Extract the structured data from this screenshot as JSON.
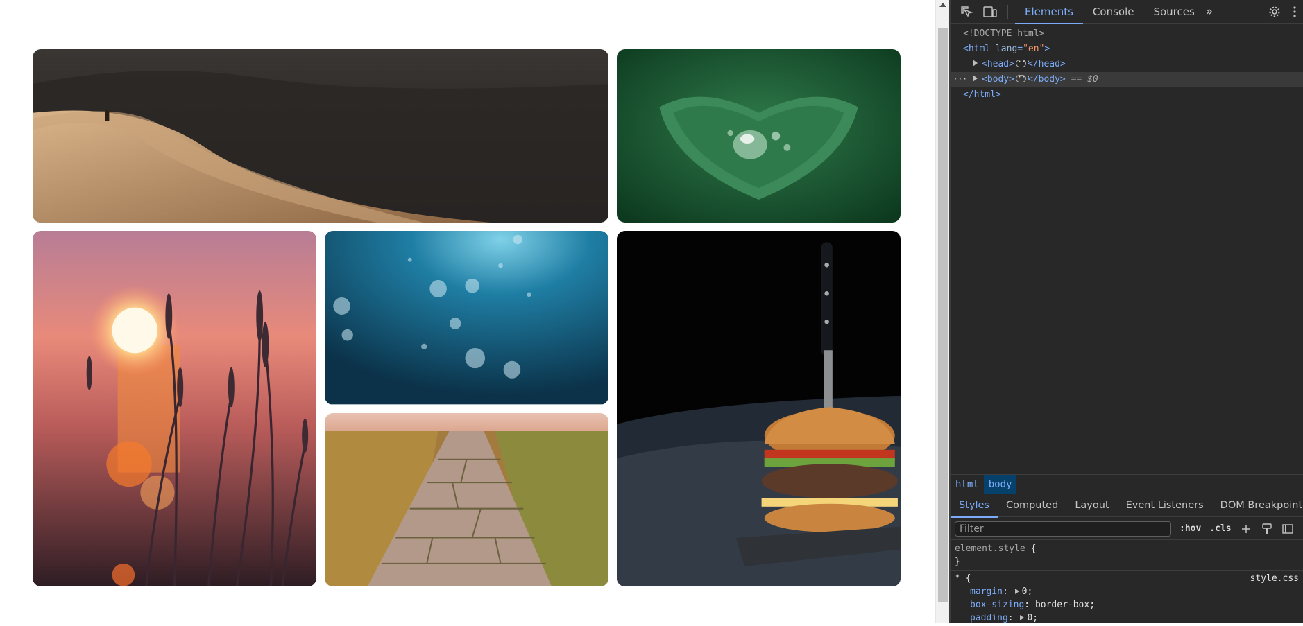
{
  "gallery": {
    "images": [
      {
        "subject": "desert dunes with hiker"
      },
      {
        "subject": "water droplet on green leaf"
      },
      {
        "subject": "sunset over grass"
      },
      {
        "subject": "underwater bubbles"
      },
      {
        "subject": "burger with knife"
      },
      {
        "subject": "stone path on hill"
      }
    ]
  },
  "devtools": {
    "tabs": [
      "Elements",
      "Console",
      "Sources"
    ],
    "active_tab": "Elements",
    "dom": {
      "doctype": "<!DOCTYPE html>",
      "html_open_tag": "<html",
      "html_attr_name": "lang",
      "html_attr_eq": "=",
      "html_attr_value": "\"en\"",
      "html_open_end": ">",
      "head_open": "<head>",
      "head_close": "</head>",
      "body_open": "<body>",
      "body_close": "</body>",
      "selected_marker": "== $0",
      "html_close": "</html>"
    },
    "breadcrumbs": [
      "html",
      "body"
    ],
    "subtabs": [
      "Styles",
      "Computed",
      "Layout",
      "Event Listeners",
      "DOM Breakpoints"
    ],
    "filter_placeholder": "Filter",
    "hov_label": ":hov",
    "cls_label": ".cls",
    "styles": {
      "element_style_selector": "element.style",
      "open_brace": "{",
      "close_brace": "}",
      "universal_selector": "*",
      "source_file": "style.css",
      "declarations": [
        {
          "name": "margin",
          "value": "0",
          "has_triangle": true
        },
        {
          "name": "box-sizing",
          "value": "border-box",
          "has_triangle": false
        },
        {
          "name": "padding",
          "value": "0",
          "has_triangle": true
        }
      ]
    },
    "accent_color": "#7cacf8",
    "background_color": "#282828"
  }
}
